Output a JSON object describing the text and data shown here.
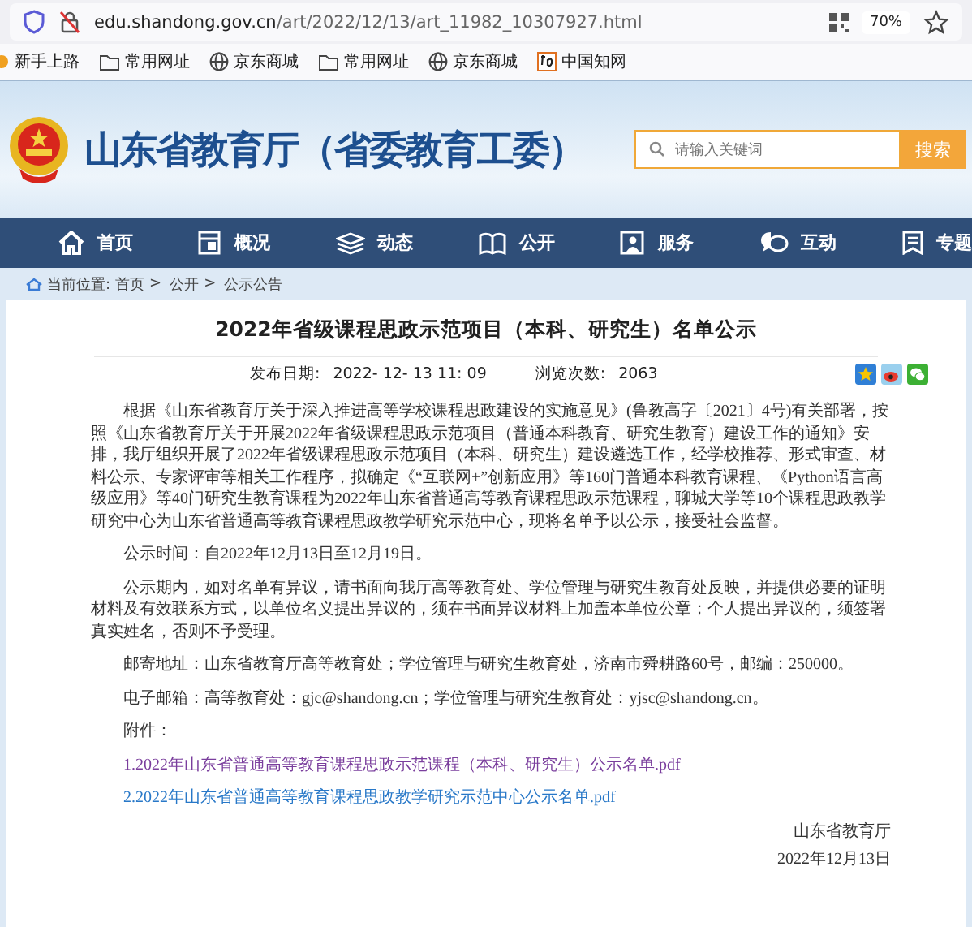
{
  "browser": {
    "url_host": "edu.shandong.gov.cn",
    "url_path": "/art/2022/12/13/art_11982_10307927.html",
    "zoom": "70%"
  },
  "bookmarks": [
    {
      "label": "新手上路",
      "kind": "dot"
    },
    {
      "label": "常用网址",
      "kind": "folder"
    },
    {
      "label": "京东商城",
      "kind": "globe"
    },
    {
      "label": "常用网址",
      "kind": "folder"
    },
    {
      "label": "京东商城",
      "kind": "globe"
    },
    {
      "label": "中国知网",
      "kind": "zhi"
    }
  ],
  "header": {
    "site_title": "山东省教育厅（省委教育工委）",
    "search_placeholder": "请输入关键词",
    "search_button": "搜索"
  },
  "nav": [
    {
      "label": "首页",
      "kind": "home"
    },
    {
      "label": "概况",
      "kind": "panel"
    },
    {
      "label": "动态",
      "kind": "stack"
    },
    {
      "label": "公开",
      "kind": "book"
    },
    {
      "label": "服务",
      "kind": "person"
    },
    {
      "label": "互动",
      "kind": "chat"
    },
    {
      "label": "专题",
      "kind": "doc"
    }
  ],
  "breadcrumb": {
    "label": "当前位置:",
    "separator": ">",
    "items": [
      "首页",
      "公开",
      "公示公告"
    ]
  },
  "article": {
    "title": "2022年省级课程思政示范项目（本科、研究生）名单公示",
    "meta": [
      {
        "label": "发布日期:",
        "value": "2022- 12- 13 11: 09"
      },
      {
        "label": "浏览次数:",
        "value": "2063"
      }
    ],
    "paragraphs": [
      "根据《山东省教育厅关于深入推进高等学校课程思政建设的实施意见》(鲁教高字〔2021〕4号)有关部署，按照《山东省教育厅关于开展2022年省级课程思政示范项目（普通本科教育、研究生教育）建设工作的通知》安排，我厅组织开展了2022年省级课程思政示范项目（本科、研究生）建设遴选工作，经学校推荐、形式审查、材料公示、专家评审等相关工作程序，拟确定《“互联网+”创新应用》等160门普通本科教育课程、《Python语言高级应用》等40门研究生教育课程为2022年山东省普通高等教育课程思政示范课程，聊城大学等10个课程思政教学研究中心为山东省普通高等教育课程思政教学研究示范中心，现将名单予以公示，接受社会监督。",
      "公示时间：自2022年12月13日至12月19日。",
      "公示期内，如对名单有异议，请书面向我厅高等教育处、学位管理与研究生教育处反映，并提供必要的证明材料及有效联系方式，以单位名义提出异议的，须在书面异议材料上加盖本单位公章；个人提出异议的，须签署真实姓名，否则不予受理。",
      "邮寄地址：山东省教育厅高等教育处；学位管理与研究生教育处，济南市舜耕路60号，邮编：250000。",
      "电子邮箱：高等教育处：gjc@shandong.cn；学位管理与研究生教育处：yjsc@shandong.cn。",
      "附件："
    ],
    "attachments": [
      {
        "text": "1.2022年山东省普通高等教育课程思政示范课程（本科、研究生）公示名单.pdf",
        "visited": true
      },
      {
        "text": "2.2022年山东省普通高等教育课程思政教学研究示范中心公示名单.pdf",
        "visited": false
      }
    ],
    "signature": [
      "山东省教育厅",
      "2022年12月13日"
    ]
  }
}
